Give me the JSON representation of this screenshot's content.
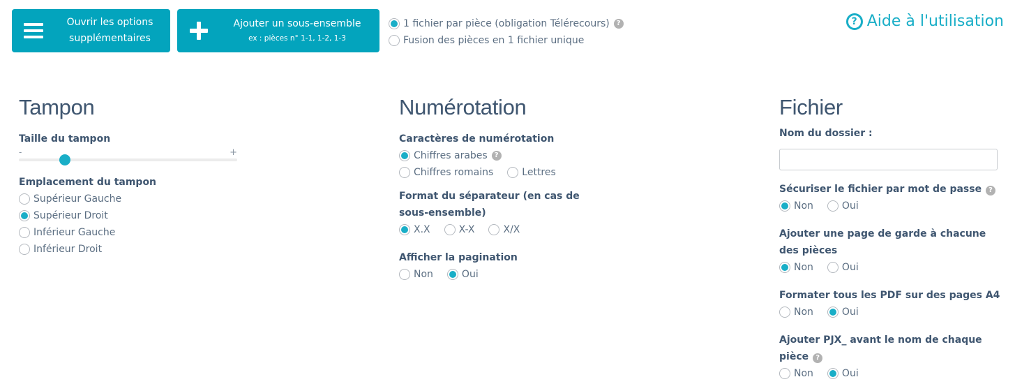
{
  "toolbar": {
    "options_button": {
      "label_line1": "Ouvrir les options",
      "label_line2": "supplémentaires",
      "icon": "hamburger-menu-icon"
    },
    "subset_button": {
      "label": "Ajouter un sous-ensemble",
      "sublabel": "ex : pièces n° 1-1, 1-2, 1-3",
      "icon": "plus-icon"
    },
    "file_mode": {
      "options": [
        {
          "label": "1 fichier par pièce (obligation Télérecours)",
          "selected": true,
          "help": true
        },
        {
          "label": "Fusion des pièces en 1 fichier unique",
          "selected": false
        }
      ]
    },
    "help_link": {
      "label": "Aide à l'utilisation",
      "icon": "question-circle-icon"
    }
  },
  "colors": {
    "accent": "#03a4bd",
    "radio_fill": "#19aec7",
    "heading": "#3f5670",
    "help_icon": "#b2b2b2"
  },
  "tampon": {
    "title": "Tampon",
    "size_label": "Taille du tampon",
    "slider": {
      "min_label": "-",
      "max_label": "+",
      "value_fraction": 0.21
    },
    "location_label": "Emplacement du tampon",
    "locations": [
      {
        "label": "Supérieur Gauche",
        "selected": false
      },
      {
        "label": "Supérieur Droit",
        "selected": true
      },
      {
        "label": "Inférieur Gauche",
        "selected": false
      },
      {
        "label": "Inférieur Droit",
        "selected": false
      }
    ]
  },
  "numerotation": {
    "title": "Numérotation",
    "chars_label": "Caractères de numérotation",
    "chars": [
      {
        "label": "Chiffres arabes",
        "selected": true,
        "help": true
      },
      {
        "label": "Chiffres romains",
        "selected": false
      },
      {
        "label": "Lettres",
        "selected": false
      }
    ],
    "separator_label": "Format du séparateur (en cas de sous-ensemble)",
    "separators": [
      {
        "label": "X.X",
        "selected": true
      },
      {
        "label": "X-X",
        "selected": false
      },
      {
        "label": "X/X",
        "selected": false
      }
    ],
    "pagination_label": "Afficher la pagination",
    "pagination": [
      {
        "label": "Non",
        "selected": false
      },
      {
        "label": "Oui",
        "selected": true
      }
    ]
  },
  "fichier": {
    "title": "Fichier",
    "folder_label": "Nom du dossier :",
    "folder_value": "",
    "password_label": "Sécuriser le fichier par mot de passe",
    "password": [
      {
        "label": "Non",
        "selected": true
      },
      {
        "label": "Oui",
        "selected": false
      }
    ],
    "cover_label": "Ajouter une page de garde à chacune des pièces",
    "cover": [
      {
        "label": "Non",
        "selected": true
      },
      {
        "label": "Oui",
        "selected": false
      }
    ],
    "a4_label": "Formater tous les PDF sur des pages A4",
    "a4": [
      {
        "label": "Non",
        "selected": false
      },
      {
        "label": "Oui",
        "selected": true
      }
    ],
    "prefix_label": "Ajouter PJX_ avant le nom de chaque pièce",
    "prefix": [
      {
        "label": "Non",
        "selected": false
      },
      {
        "label": "Oui",
        "selected": true
      }
    ]
  }
}
